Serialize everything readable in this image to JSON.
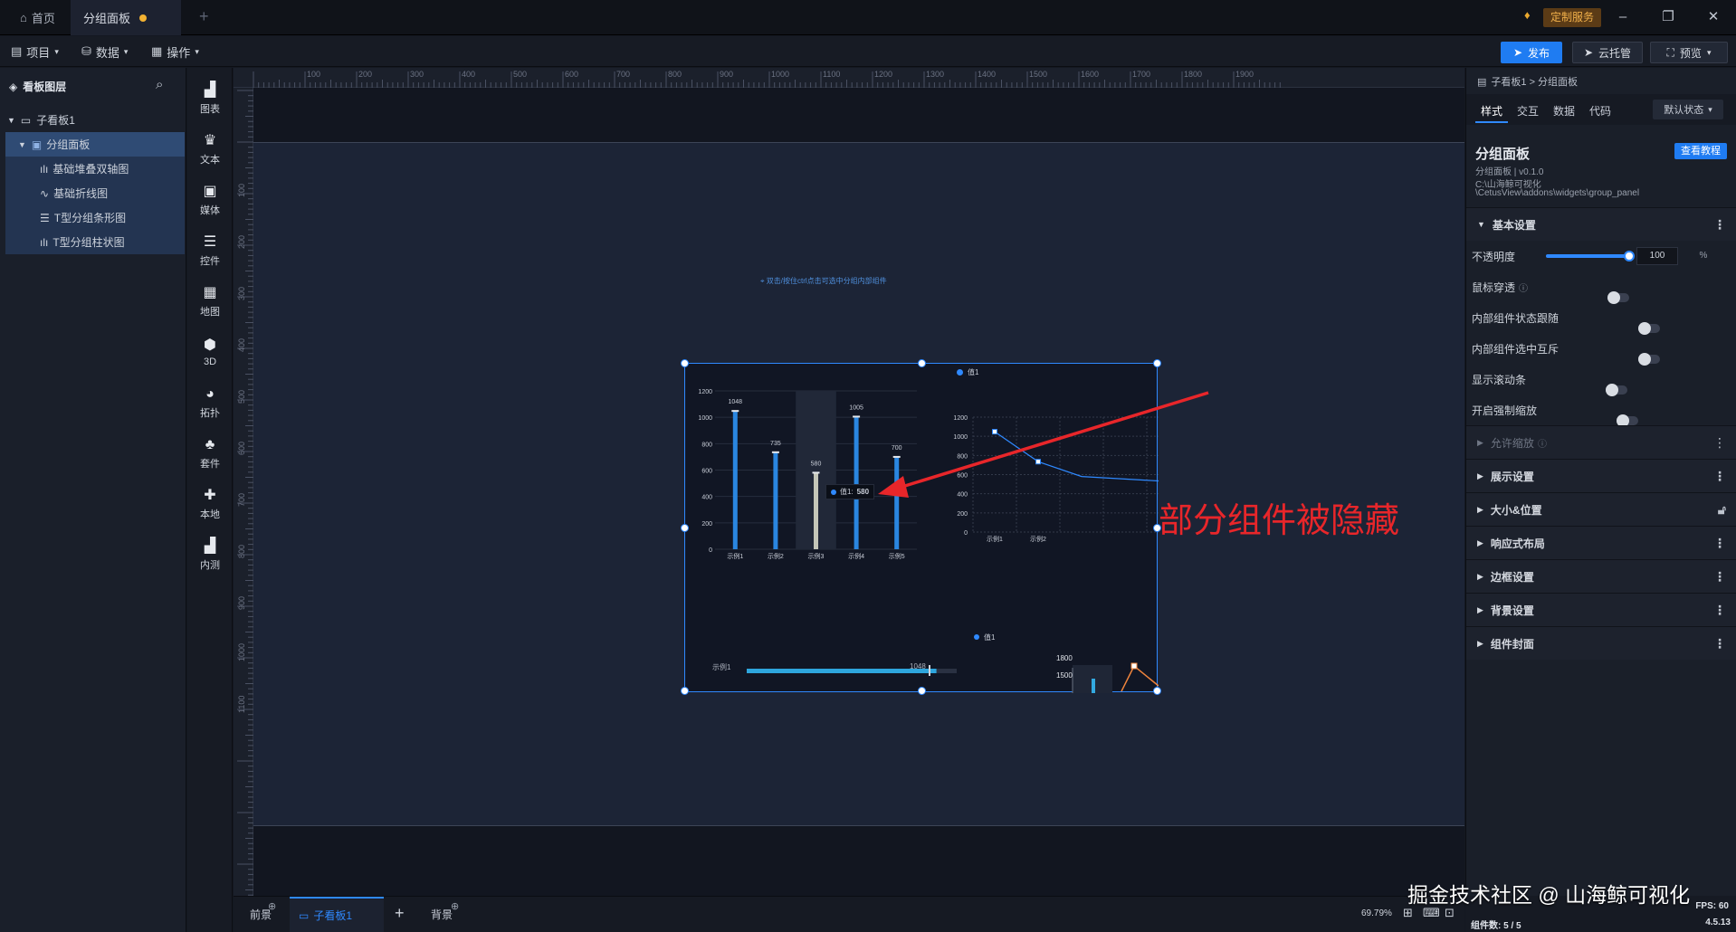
{
  "titlebar": {
    "tabs": [
      {
        "label": "首页"
      },
      {
        "label": "分组面板"
      }
    ],
    "service_label": "定制服务"
  },
  "menubar": {
    "menus": [
      "项目",
      "数据",
      "操作"
    ],
    "publish": "发布",
    "cloud": "云托管",
    "preview": "预览"
  },
  "layers": {
    "title": "看板图层",
    "items": [
      {
        "label": "子看板1"
      },
      {
        "label": "分组面板"
      },
      {
        "label": "基础堆叠双轴图"
      },
      {
        "label": "基础折线图"
      },
      {
        "label": "T型分组条形图"
      },
      {
        "label": "T型分组柱状图"
      }
    ]
  },
  "toolbox": [
    "图表",
    "文本",
    "媒体",
    "控件",
    "地图",
    "3D",
    "拓扑",
    "套件",
    "本地",
    "内测"
  ],
  "ruler": {
    "h": [
      "100",
      "200",
      "300",
      "400",
      "500",
      "600",
      "700",
      "800",
      "900",
      "1000",
      "1100",
      "1200",
      "1300",
      "1400",
      "1500",
      "1600",
      "1700",
      "1800",
      "1900"
    ],
    "v": [
      "100",
      "200",
      "300",
      "400",
      "500",
      "600",
      "700",
      "800",
      "900",
      "1000",
      "1100"
    ]
  },
  "canvas": {
    "hint": "双击/按住ctrl点击可选中分组内部组件",
    "annotation": "部分组件被隐藏",
    "bar_legend": "值1",
    "tooltip_label": "值1:",
    "tooltip_value": "580",
    "hbar_label": "示例1",
    "hbar_value": "1048",
    "legend2": "值1",
    "mini_y": [
      "1800",
      "1500"
    ]
  },
  "chart_data": [
    {
      "type": "bar",
      "categories": [
        "示例1",
        "示例2",
        "示例3",
        "示例4",
        "示例5"
      ],
      "values": [
        1048,
        735,
        580,
        1005,
        700
      ],
      "ylim": [
        0,
        1200
      ],
      "yticks": [
        "0",
        "200",
        "400",
        "600",
        "800",
        "1000",
        "1200"
      ],
      "data_labels": [
        "1048",
        "735",
        "580",
        "1005",
        "700"
      ],
      "legend": "值1"
    },
    {
      "type": "line",
      "categories": [
        "示例1",
        "示例2"
      ],
      "values": [
        1048,
        735,
        580
      ],
      "ylim": [
        0,
        1200
      ],
      "yticks": [
        "0",
        "200",
        "400",
        "600",
        "800",
        "1000",
        "1200"
      ]
    }
  ],
  "props": {
    "breadcrumb": "子看板1 > 分组面板",
    "tabs": [
      "样式",
      "交互",
      "数据",
      "代码"
    ],
    "state": "默认状态",
    "name": "分组面板",
    "version": "分组面板 | v0.1.0",
    "path1": "C:\\山海鲸可视化",
    "path2": "\\CetusView\\addons\\widgets\\group_panel",
    "tutorial": "查看教程",
    "basic": "基本设置",
    "opacity": "不透明度",
    "opacity_value": "100",
    "opacity_unit": "%",
    "opacity_level": 1.0,
    "rows": [
      "鼠标穿透",
      "内部组件状态跟随",
      "内部组件选中互斥",
      "显示滚动条",
      "开启强制缩放"
    ],
    "allow_zoom": "允许缩放",
    "sections": [
      "展示设置",
      "大小&位置",
      "响应式布局",
      "边框设置",
      "背景设置",
      "组件封面"
    ]
  },
  "bottom": {
    "front": "前景",
    "board": "子看板1",
    "back": "背景",
    "zoom": "69.79%",
    "fps": "FPS: 60",
    "count": "组件数: 5 / 5",
    "version": "4.5.13",
    "watermark": "掘金技术社区 @ 山海鲸可视化"
  }
}
